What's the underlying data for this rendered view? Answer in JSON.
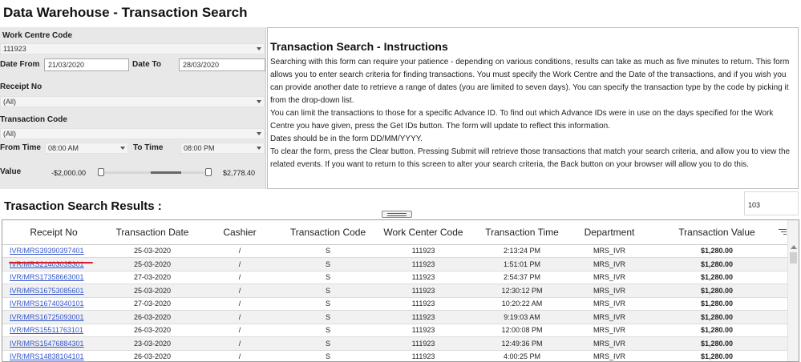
{
  "app": {
    "title": "Data Warehouse - Transaction Search"
  },
  "form": {
    "work_centre_label": "Work Centre Code",
    "work_centre_value": "111923",
    "date_from_label": "Date From",
    "date_from_value": "21/03/2020",
    "date_to_label": "Date To",
    "date_to_value": "28/03/2020",
    "receipt_no_label": "Receipt No",
    "receipt_no_value": "(All)",
    "transaction_code_label": "Transaction Code",
    "transaction_code_value": "(All)",
    "from_time_label": "From Time",
    "from_time_value": "08:00 AM",
    "to_time_label": "To Time",
    "to_time_value": "08:00 PM",
    "value_label": "Value",
    "value_min": "-$2,000.00",
    "value_max": "$2,778.40",
    "slider_range_fraction": [
      0.46,
      0.74
    ]
  },
  "instructions": {
    "title": "Transaction Search - Instructions",
    "paragraphs": [
      "Searching with this form can require your patience - depending on various conditions, results can take as much as five minutes to return. This form allows you to enter search criteria for finding transactions. You must specify the Work Centre and the Date of the transactions, and if you wish you can provide another date to retrieve a range of dates (you are limited to seven days). You can specify the transaction type by the code by picking it from the drop-down list.",
      "You can limit the transactions to those for a specific Advance ID. To find out which Advance IDs were in use on the days specified for the Work Centre you have given, press the Get IDs button. The form will update to reflect this information.",
      "Dates should be in the form DD/MM/YYYY.",
      "To clear the form, press the Clear button. Pressing Submit will retrieve those transactions that match your search criteria, and allow you to view the related events. If you want to return to this screen to alter your search criteria, the Back button on your browser will allow you to do this."
    ]
  },
  "results": {
    "title": "Trasaction Search Results :",
    "count": "103",
    "columns": [
      "Receipt No",
      "Transaction Date",
      "Cashier",
      "Transaction Code",
      "Work Center Code",
      "Transaction Time",
      "Department",
      "Transaction Value"
    ],
    "rows": [
      [
        "IVR/MRS39390397401",
        "25-03-2020",
        "/",
        "S",
        "111923",
        "2:13:24 PM",
        "MRS_IVR",
        "$1,280.00"
      ],
      [
        "IVR/MRS21403035301",
        "25-03-2020",
        "/",
        "S",
        "111923",
        "1:51:01 PM",
        "MRS_IVR",
        "$1,280.00"
      ],
      [
        "IVR/MRS17358663001",
        "27-03-2020",
        "/",
        "S",
        "111923",
        "2:54:37 PM",
        "MRS_IVR",
        "$1,280.00"
      ],
      [
        "IVR/MRS16753085601",
        "25-03-2020",
        "/",
        "S",
        "111923",
        "12:30:12 PM",
        "MRS_IVR",
        "$1,280.00"
      ],
      [
        "IVR/MRS16740340101",
        "27-03-2020",
        "/",
        "S",
        "111923",
        "10:20:22 AM",
        "MRS_IVR",
        "$1,280.00"
      ],
      [
        "IVR/MRS16725093001",
        "26-03-2020",
        "/",
        "S",
        "111923",
        "9:19:03 AM",
        "MRS_IVR",
        "$1,280.00"
      ],
      [
        "IVR/MRS15511763101",
        "26-03-2020",
        "/",
        "S",
        "111923",
        "12:00:08 PM",
        "MRS_IVR",
        "$1,280.00"
      ],
      [
        "IVR/MRS15476884301",
        "23-03-2020",
        "/",
        "S",
        "111923",
        "12:49:36 PM",
        "MRS_IVR",
        "$1,280.00"
      ],
      [
        "IVR/MRS14838104101",
        "26-03-2020",
        "/",
        "S",
        "111923",
        "4:00:25 PM",
        "MRS_IVR",
        "$1,280.00"
      ]
    ]
  },
  "colors": {
    "link": "#3355cc",
    "annotation": "#d21f2e",
    "panel": "#e8e8e8"
  },
  "icons": [
    "dropdown-arrow-icon",
    "filter-lines-icon",
    "drag-handle-icon",
    "scroll-up-icon"
  ]
}
